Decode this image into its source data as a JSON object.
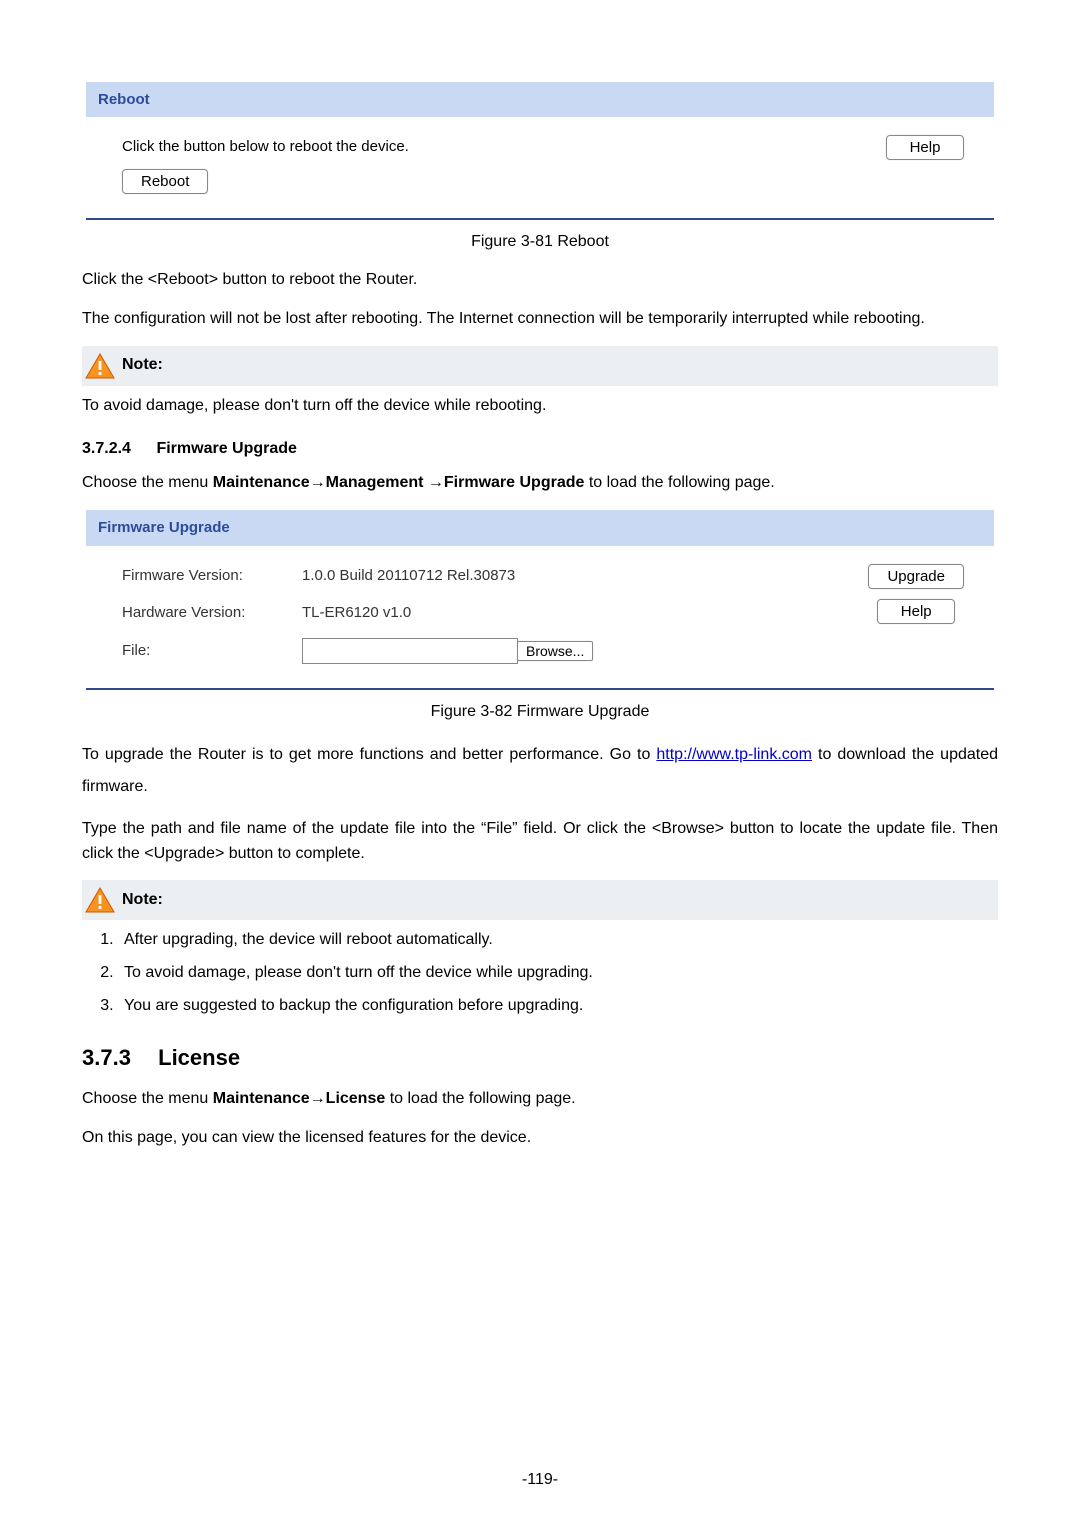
{
  "reboot_panel": {
    "title": "Reboot",
    "instruction": "Click the button below to reboot the device.",
    "reboot_btn": "Reboot",
    "help_btn": "Help"
  },
  "fig81_caption": "Figure 3-81 Reboot",
  "para_reboot_click": "Click the <Reboot> button to reboot the Router.",
  "para_reboot_cfg": "The configuration will not be lost after rebooting. The Internet connection will be temporarily interrupted while rebooting.",
  "note_label": "Note:",
  "note1_text": "To avoid damage, please don't turn off the device while rebooting.",
  "heading_3724": {
    "no": "3.7.2.4",
    "title": "Firmware Upgrade"
  },
  "para_fw_menu_pre": "Choose the menu ",
  "para_fw_menu_bold": "Maintenance→Management →Firmware Upgrade",
  "para_fw_menu_post": " to load the following page.",
  "fw_panel": {
    "title": "Firmware Upgrade",
    "fw_version_label": "Firmware Version:",
    "fw_version_value": "1.0.0 Build 20110712 Rel.30873",
    "hw_version_label": "Hardware Version:",
    "hw_version_value": "TL-ER6120 v1.0",
    "file_label": "File:",
    "browse_btn": "Browse...",
    "upgrade_btn": "Upgrade",
    "help_btn": "Help"
  },
  "fig82_caption": "Figure 3-82 Firmware Upgrade",
  "para_upgrade_go_pre": "To upgrade the Router is to get more functions and better performance. Go to ",
  "para_upgrade_link": "http://www.tp-link.com",
  "para_upgrade_go_post": " to download the updated firmware.",
  "para_upgrade_file": "Type the path and file name of the update file into the “File” field. Or click the <Browse> button to locate the update file. Then click the <Upgrade> button to complete.",
  "note2_items": [
    "After upgrading, the device will reboot automatically.",
    "To avoid damage, please don't turn off the device while upgrading.",
    "You are suggested to backup the configuration before upgrading."
  ],
  "heading_373": {
    "no": "3.7.3",
    "title": "License"
  },
  "para_license_menu_pre": "Choose the menu ",
  "para_license_menu_bold": "Maintenance→License",
  "para_license_menu_post": " to load the following page.",
  "para_license_view": "On this page, you can view the licensed features for the device.",
  "page_number": "-119-"
}
